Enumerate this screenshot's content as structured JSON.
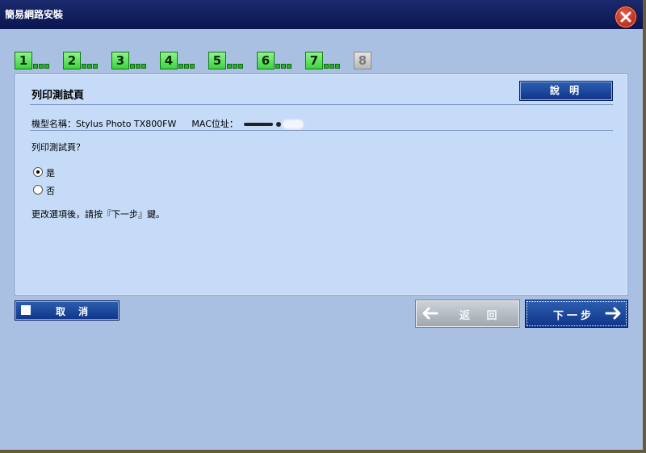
{
  "window": {
    "title": "簡易網路安裝"
  },
  "steps": [
    {
      "label": "1",
      "state": "done"
    },
    {
      "label": "2",
      "state": "done"
    },
    {
      "label": "3",
      "state": "done"
    },
    {
      "label": "4",
      "state": "done"
    },
    {
      "label": "5",
      "state": "done"
    },
    {
      "label": "6",
      "state": "done"
    },
    {
      "label": "7",
      "state": "done"
    },
    {
      "label": "8",
      "state": "pending"
    }
  ],
  "panel": {
    "title": "列印測試頁",
    "help_label": "說 明",
    "model_label": "機型名稱：",
    "model_value": "Stylus Photo TX800FW",
    "mac_label": "MAC位址：",
    "question": "列印測試頁？",
    "options": [
      {
        "label": "是",
        "checked": true
      },
      {
        "label": "否",
        "checked": false
      }
    ],
    "instruction": "更改選項後，請按『下一步』鍵。"
  },
  "footer": {
    "cancel_label": "取 消",
    "back_label": "返 回",
    "next_label": "下一步"
  },
  "colors": {
    "window_bg": "#a9c0e2",
    "titlebar": "#0b1650",
    "panel_bg": "#c5dbf8",
    "button_blue": "#10348a",
    "step_green": "#3ed43e",
    "close_red": "#a81c10"
  },
  "icons": {
    "close": "close-x-icon",
    "back": "arrow-left-icon",
    "next": "arrow-right-icon",
    "cancel": "square-icon"
  }
}
